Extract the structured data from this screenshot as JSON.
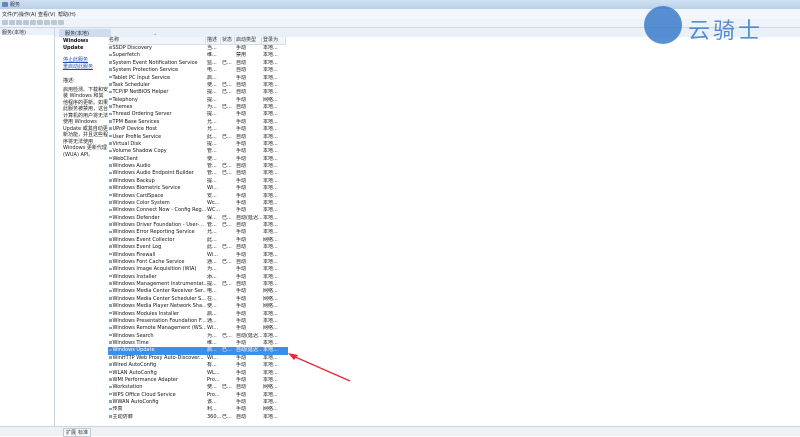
{
  "window": {
    "title": "服务"
  },
  "menu": [
    "文件(F)",
    "操作(A)",
    "查看(V)",
    "帮助(H)"
  ],
  "tree": {
    "root": "服务(本地)"
  },
  "tab": {
    "label": "服务(本地)"
  },
  "description": {
    "service_title": "Windows Update",
    "stop_link": "停止此服务",
    "restart_link": "重启动此服务",
    "heading": "描述:",
    "text": "启用检测、下载和安装 Windows 和其他程序的更新。如果此服务被禁用，这台计算机的用户将无法使用 Windows Update 或其自动更新功能，并且这些程序将无法使用 Windows 更新代理(WUA) API。"
  },
  "columns": {
    "name": "名称",
    "desc": "描述",
    "status": "状态",
    "startup": "启动类型",
    "logon": "登录为"
  },
  "services": [
    {
      "name": "SSDP Discovery",
      "desc": "当...",
      "status": "",
      "startup": "手动",
      "logon": "本地..."
    },
    {
      "name": "Superfetch",
      "desc": "维...",
      "status": "",
      "startup": "禁用",
      "logon": "本地..."
    },
    {
      "name": "System Event Notification Service",
      "desc": "监...",
      "status": "已...",
      "startup": "自动",
      "logon": "本地..."
    },
    {
      "name": "System Protection Service",
      "desc": "电...",
      "status": "",
      "startup": "自动",
      "logon": "本地..."
    },
    {
      "name": "Tablet PC Input Service",
      "desc": "启...",
      "status": "",
      "startup": "手动",
      "logon": "本地..."
    },
    {
      "name": "Task Scheduler",
      "desc": "使...",
      "status": "已...",
      "startup": "自动",
      "logon": "本地..."
    },
    {
      "name": "TCP/IP NetBIOS Helper",
      "desc": "提...",
      "status": "已...",
      "startup": "自动",
      "logon": "本地..."
    },
    {
      "name": "Telephony",
      "desc": "提...",
      "status": "",
      "startup": "手动",
      "logon": "网络..."
    },
    {
      "name": "Themes",
      "desc": "为...",
      "status": "已...",
      "startup": "自动",
      "logon": "本地..."
    },
    {
      "name": "Thread Ordering Server",
      "desc": "提...",
      "status": "",
      "startup": "手动",
      "logon": "本地..."
    },
    {
      "name": "TPM Base Services",
      "desc": "允...",
      "status": "",
      "startup": "手动",
      "logon": "本地..."
    },
    {
      "name": "UPnP Device Host",
      "desc": "允...",
      "status": "",
      "startup": "手动",
      "logon": "本地..."
    },
    {
      "name": "User Profile Service",
      "desc": "此...",
      "status": "已...",
      "startup": "自动",
      "logon": "本地..."
    },
    {
      "name": "Virtual Disk",
      "desc": "提...",
      "status": "",
      "startup": "手动",
      "logon": "本地..."
    },
    {
      "name": "Volume Shadow Copy",
      "desc": "管...",
      "status": "",
      "startup": "手动",
      "logon": "本地..."
    },
    {
      "name": "WebClient",
      "desc": "使...",
      "status": "",
      "startup": "手动",
      "logon": "本地..."
    },
    {
      "name": "Windows Audio",
      "desc": "管...",
      "status": "已...",
      "startup": "自动",
      "logon": "本地..."
    },
    {
      "name": "Windows Audio Endpoint Builder",
      "desc": "管...",
      "status": "已...",
      "startup": "自动",
      "logon": "本地..."
    },
    {
      "name": "Windows Backup",
      "desc": "提...",
      "status": "",
      "startup": "手动",
      "logon": "本地..."
    },
    {
      "name": "Windows Biometric Service",
      "desc": "Wi...",
      "status": "",
      "startup": "手动",
      "logon": "本地..."
    },
    {
      "name": "Windows CardSpace",
      "desc": "安...",
      "status": "",
      "startup": "手动",
      "logon": "本地..."
    },
    {
      "name": "Windows Color System",
      "desc": "Wc...",
      "status": "",
      "startup": "手动",
      "logon": "本地..."
    },
    {
      "name": "Windows Connect Now - Config Reg...",
      "desc": "WC...",
      "status": "",
      "startup": "手动",
      "logon": "本地..."
    },
    {
      "name": "Windows Defender",
      "desc": "保...",
      "status": "已...",
      "startup": "自动(延迟...",
      "logon": "本地..."
    },
    {
      "name": "Windows Driver Foundation - User-...",
      "desc": "管...",
      "status": "已...",
      "startup": "自动",
      "logon": "本地..."
    },
    {
      "name": "Windows Error Reporting Service",
      "desc": "允...",
      "status": "",
      "startup": "手动",
      "logon": "本地..."
    },
    {
      "name": "Windows Event Collector",
      "desc": "此...",
      "status": "",
      "startup": "手动",
      "logon": "网络..."
    },
    {
      "name": "Windows Event Log",
      "desc": "此...",
      "status": "已...",
      "startup": "自动",
      "logon": "本地..."
    },
    {
      "name": "Windows Firewall",
      "desc": "Wi...",
      "status": "",
      "startup": "手动",
      "logon": "本地..."
    },
    {
      "name": "Windows Font Cache Service",
      "desc": "通...",
      "status": "已...",
      "startup": "自动",
      "logon": "本地..."
    },
    {
      "name": "Windows Image Acquisition (WIA)",
      "desc": "为...",
      "status": "",
      "startup": "手动",
      "logon": "本地..."
    },
    {
      "name": "Windows Installer",
      "desc": "添...",
      "status": "",
      "startup": "手动",
      "logon": "本地..."
    },
    {
      "name": "Windows Management Instrumentat...",
      "desc": "提...",
      "status": "已...",
      "startup": "自动",
      "logon": "本地..."
    },
    {
      "name": "Windows Media Center Receiver Ser...",
      "desc": "电...",
      "status": "",
      "startup": "手动",
      "logon": "网络..."
    },
    {
      "name": "Windows Media Center Scheduler S...",
      "desc": "在...",
      "status": "",
      "startup": "手动",
      "logon": "网络..."
    },
    {
      "name": "Windows Media Player Network Sha...",
      "desc": "使...",
      "status": "",
      "startup": "手动",
      "logon": "网络..."
    },
    {
      "name": "Windows Modules Installer",
      "desc": "启...",
      "status": "",
      "startup": "手动",
      "logon": "本地..."
    },
    {
      "name": "Windows Presentation Foundation F...",
      "desc": "通...",
      "status": "",
      "startup": "手动",
      "logon": "本地..."
    },
    {
      "name": "Windows Remote Management (WS...",
      "desc": "Wi...",
      "status": "",
      "startup": "手动",
      "logon": "网络..."
    },
    {
      "name": "Windows Search",
      "desc": "为...",
      "status": "已...",
      "startup": "自动(延迟...",
      "logon": "本地..."
    },
    {
      "name": "Windows Time",
      "desc": "维...",
      "status": "",
      "startup": "手动",
      "logon": "本地..."
    },
    {
      "name": "Windows Update",
      "desc": "启...",
      "status": "已...",
      "startup": "自动(延迟...",
      "logon": "本地...",
      "selected": true
    },
    {
      "name": "WinHTTP Web Proxy Auto-Discover...",
      "desc": "Wi...",
      "status": "",
      "startup": "手动",
      "logon": "本地..."
    },
    {
      "name": "Wired AutoConfig",
      "desc": "有...",
      "status": "",
      "startup": "手动",
      "logon": "本地..."
    },
    {
      "name": "WLAN AutoConfig",
      "desc": "WL...",
      "status": "",
      "startup": "手动",
      "logon": "本地..."
    },
    {
      "name": "WMI Performance Adapter",
      "desc": "Pro...",
      "status": "",
      "startup": "手动",
      "logon": "本地..."
    },
    {
      "name": "Workstation",
      "desc": "使...",
      "status": "已...",
      "startup": "自动",
      "logon": "网络..."
    },
    {
      "name": "WPS Office Cloud Service",
      "desc": "Pro...",
      "status": "",
      "startup": "手动",
      "logon": "本地..."
    },
    {
      "name": "WWAN AutoConfig",
      "desc": "该...",
      "status": "",
      "startup": "手动",
      "logon": "本地..."
    },
    {
      "name": "传真",
      "desc": "利...",
      "status": "",
      "startup": "手动",
      "logon": "网络..."
    },
    {
      "name": "主动防御",
      "desc": "360...",
      "status": "已...",
      "startup": "自动",
      "logon": "本地..."
    }
  ],
  "status_tabs": [
    "扩展",
    "标准"
  ],
  "watermark": {
    "text": "云骑士"
  },
  "colors": {
    "selection": "#3d8ee6",
    "arrow": "#e8283a",
    "brand": "#2f74c8"
  }
}
